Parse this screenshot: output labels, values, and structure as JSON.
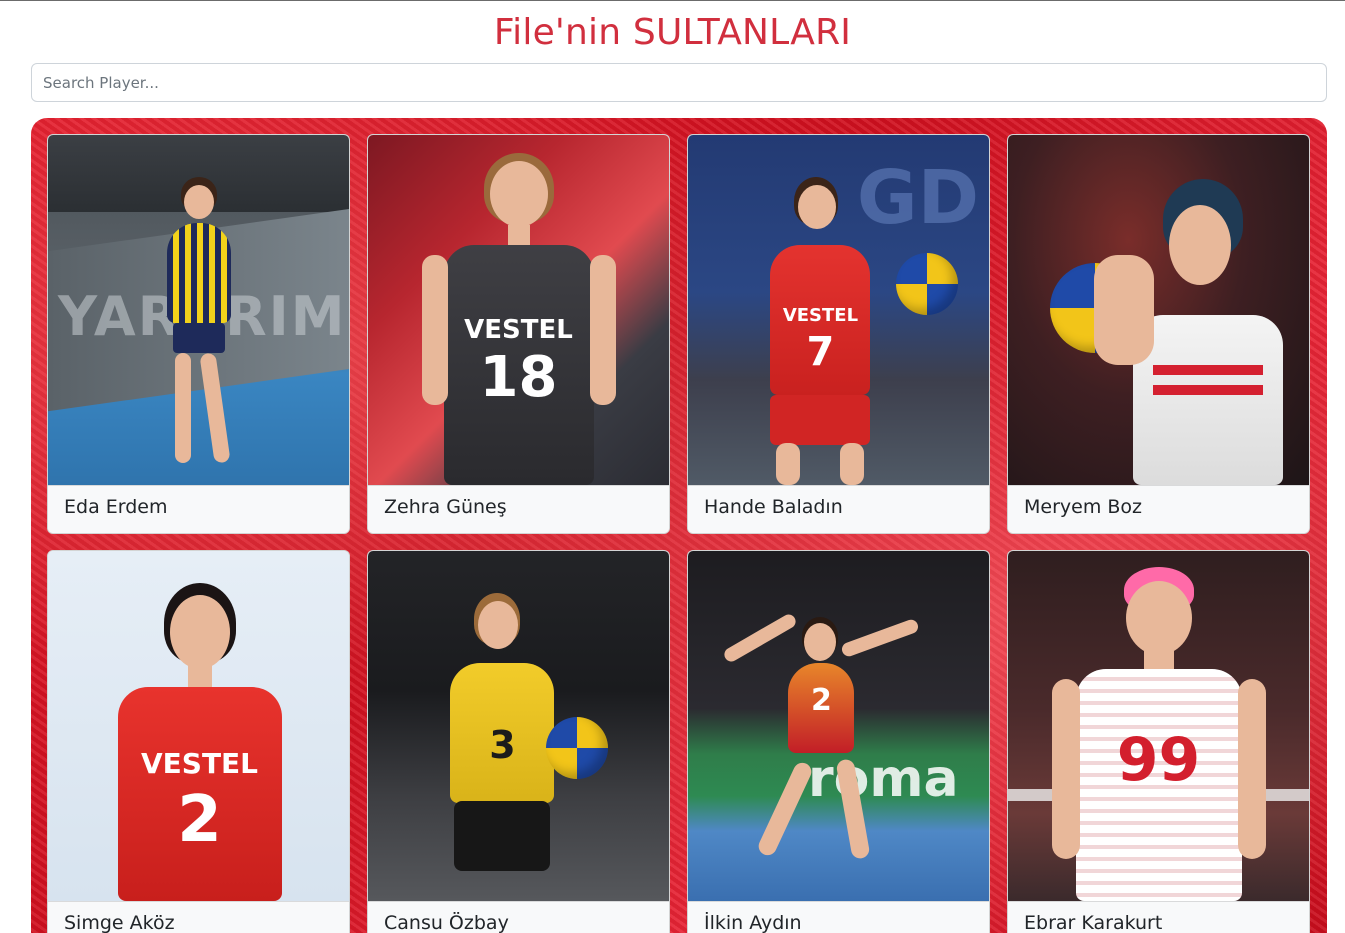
{
  "header": {
    "title": "File'nin SULTANLARI"
  },
  "search": {
    "placeholder": "Search Player..."
  },
  "players": [
    {
      "name": "Eda Erdem"
    },
    {
      "name": "Zehra Güneş"
    },
    {
      "name": "Hande Baladın"
    },
    {
      "name": "Meryem Boz"
    },
    {
      "name": "Simge Aköz"
    },
    {
      "name": "Cansu Özbay"
    },
    {
      "name": "İlkin Aydın"
    },
    {
      "name": "Ebrar Karakurt"
    }
  ],
  "colors": {
    "title": "#d12f3e",
    "panel": "#e31b2b",
    "card_bg": "#f8f9fa"
  }
}
